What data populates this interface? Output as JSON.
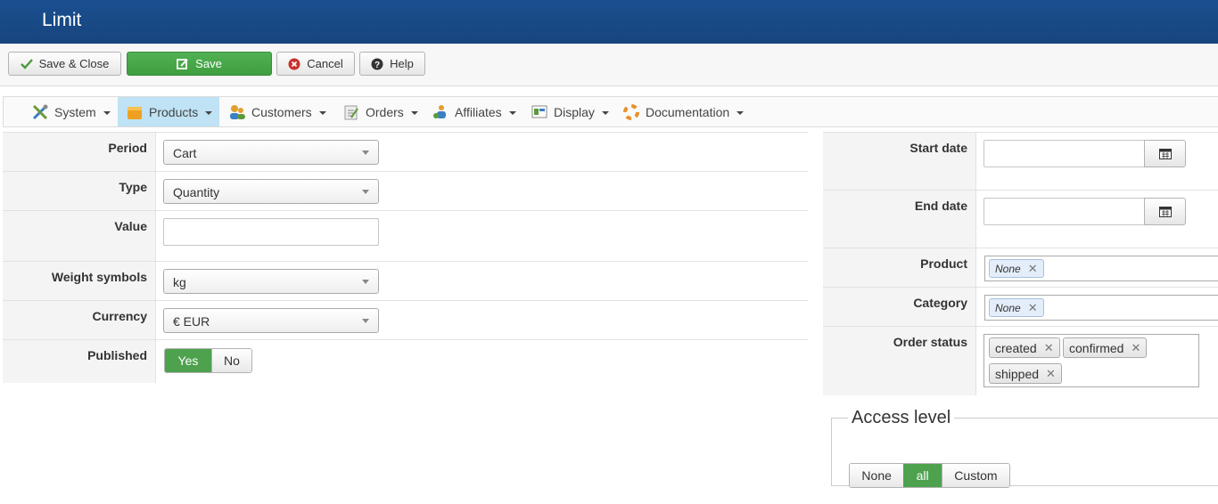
{
  "header": {
    "title": "Limit"
  },
  "toolbar": {
    "save_close": "Save & Close",
    "save": "Save",
    "cancel": "Cancel",
    "help": "Help"
  },
  "menu": {
    "items": [
      {
        "label": "System",
        "icon": "tools-icon"
      },
      {
        "label": "Products",
        "icon": "box-icon"
      },
      {
        "label": "Customers",
        "icon": "users-icon"
      },
      {
        "label": "Orders",
        "icon": "orders-icon"
      },
      {
        "label": "Affiliates",
        "icon": "affiliates-icon"
      },
      {
        "label": "Display",
        "icon": "display-icon"
      },
      {
        "label": "Documentation",
        "icon": "lifebuoy-icon"
      }
    ],
    "active": "Products"
  },
  "form_left": {
    "period": {
      "label": "Period",
      "value": "Cart"
    },
    "type": {
      "label": "Type",
      "value": "Quantity"
    },
    "value": {
      "label": "Value",
      "value": ""
    },
    "weight": {
      "label": "Weight symbols",
      "value": "kg"
    },
    "currency": {
      "label": "Currency",
      "value": "€ EUR"
    },
    "published": {
      "label": "Published",
      "yes": "Yes",
      "no": "No",
      "selected": "Yes"
    }
  },
  "form_right": {
    "start_date": {
      "label": "Start date",
      "value": ""
    },
    "end_date": {
      "label": "End date",
      "value": ""
    },
    "product": {
      "label": "Product",
      "tags": [
        "None"
      ]
    },
    "category": {
      "label": "Category",
      "tags": [
        "None"
      ]
    },
    "order_status": {
      "label": "Order status",
      "tags": [
        "created",
        "confirmed",
        "shipped"
      ]
    }
  },
  "access": {
    "legend": "Access level",
    "options": [
      "None",
      "all",
      "Custom"
    ],
    "selected": "all"
  },
  "colors": {
    "header": "#17457e",
    "accent_green": "#4ea24e",
    "menu_active": "#bfe2f4"
  }
}
